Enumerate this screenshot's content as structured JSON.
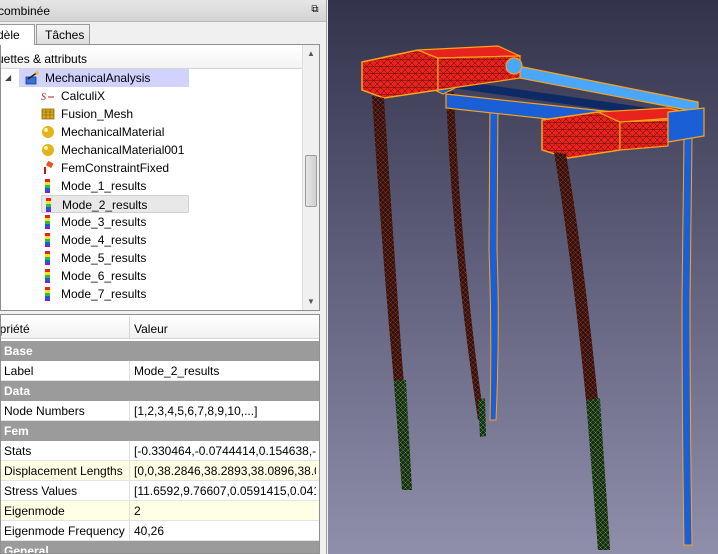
{
  "panel": {
    "title": "combinée",
    "tabs": [
      {
        "label": "dèle",
        "active": true
      },
      {
        "label": "Tâches",
        "active": false
      }
    ]
  },
  "tree": {
    "header": "uettes & attributs",
    "analysis": {
      "label": "MechanicalAnalysis",
      "icon": "analysis-icon"
    },
    "items": [
      {
        "label": "CalculiX",
        "icon": "calculix-solver-icon"
      },
      {
        "label": "Fusion_Mesh",
        "icon": "fem-mesh-icon"
      },
      {
        "label": "MechanicalMaterial",
        "icon": "material-sphere-icon"
      },
      {
        "label": "MechanicalMaterial001",
        "icon": "material-sphere-icon"
      },
      {
        "label": "FemConstraintFixed",
        "icon": "constraint-fixed-icon"
      },
      {
        "label": "Mode_1_results",
        "icon": "results-colorbar-icon"
      },
      {
        "label": "Mode_2_results",
        "icon": "results-colorbar-icon",
        "selected": true
      },
      {
        "label": "Mode_3_results",
        "icon": "results-colorbar-icon"
      },
      {
        "label": "Mode_4_results",
        "icon": "results-colorbar-icon"
      },
      {
        "label": "Mode_5_results",
        "icon": "results-colorbar-icon"
      },
      {
        "label": "Mode_6_results",
        "icon": "results-colorbar-icon"
      },
      {
        "label": "Mode_7_results",
        "icon": "results-colorbar-icon"
      }
    ]
  },
  "properties": {
    "col_property": "opriété",
    "col_value": "Valeur",
    "groups": {
      "base": "Base",
      "data": "Data",
      "fem": "Fem",
      "general": "General"
    },
    "rows": {
      "label": {
        "name": "Label",
        "value": "Mode_2_results"
      },
      "node_numbers": {
        "name": "Node Numbers",
        "value": "[1,2,3,4,5,6,7,8,9,10,...]"
      },
      "stats": {
        "name": "Stats",
        "value": "[-0.330464,-0.0744414,0.154638,-..."
      },
      "displacement_lengths": {
        "name": "Displacement Lengths",
        "value": "[0,0,38.2846,38.2893,38.0896,38.0..."
      },
      "stress_values": {
        "name": "Stress Values",
        "value": "[11.6592,9.76607,0.0591415,0.041..."
      },
      "eigenmode": {
        "name": "Eigenmode",
        "value": "2"
      },
      "eigenmode_frequency": {
        "name": "Eigenmode Frequency",
        "value": "40,26"
      }
    }
  },
  "colors": {
    "mesh_red": "#e8231d",
    "mesh_blue": "#1a5fd6",
    "mesh_green": "#39b54a",
    "selection_orange": "#ffa21a",
    "viewport_top": "#33334c",
    "viewport_bottom": "#8f8fab"
  }
}
